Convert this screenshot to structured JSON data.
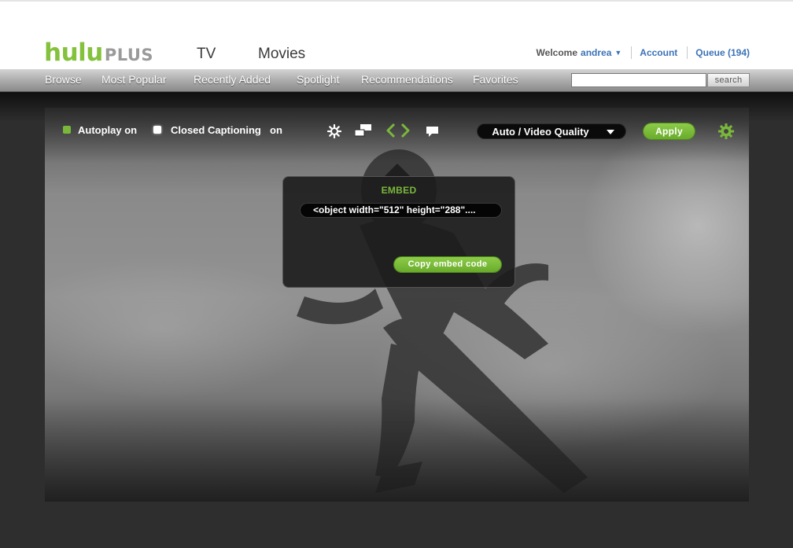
{
  "brand": {
    "logo_main": "hulu",
    "logo_sub": "PLUS",
    "accent_color": "#7ab83b"
  },
  "main_tabs": [
    "TV",
    "Movies"
  ],
  "user": {
    "welcome": "Welcome",
    "name": "andrea",
    "account_link": "Account",
    "queue_link": "Queue (194)"
  },
  "nav": {
    "items": [
      "Browse",
      "Most Popular",
      "Recently Added",
      "Spotlight",
      "Recommendations",
      "Favorites"
    ],
    "search": {
      "value": "",
      "button": "search"
    }
  },
  "player": {
    "autoplay": {
      "label": "Autoplay on",
      "checked": true
    },
    "closed_captioning": {
      "label": "Closed Captioning",
      "state": "on",
      "checked": false
    },
    "quality": "Auto / Video Quality",
    "apply": "Apply",
    "icons": [
      "settings-small-icon",
      "resize-icon",
      "embed-code-icon",
      "comment-icon",
      "gear-icon"
    ],
    "embed_popup": {
      "title": "EMBED",
      "code": "<object width=\"512\" height=\"288\"....",
      "copy_button": "Copy embed code"
    }
  }
}
